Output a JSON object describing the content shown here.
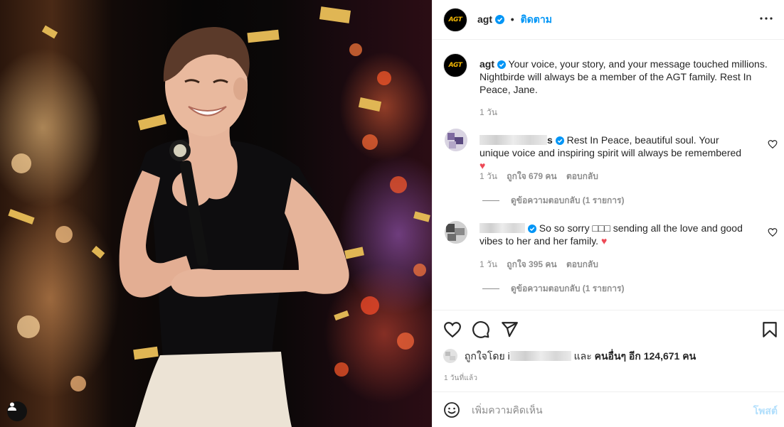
{
  "header": {
    "username": "agt",
    "avatar_logo_text": "AGT",
    "follow_label": "ติดตาม",
    "more_icon": "more-horizontal-icon"
  },
  "caption": {
    "username": "agt",
    "text": "Your voice, your story, and your message touched millions. Nightbirde will always be a member of the AGT family. Rest In Peace, Jane.",
    "time": "1 วัน"
  },
  "comments": [
    {
      "username_suffix": "s",
      "text": "Rest In Peace, beautiful soul. Your unique voice and inspiring spirit will always be remembered",
      "emoji": "♥",
      "time": "1 วัน",
      "likes": "ถูกใจ 679 คน",
      "reply_label": "ตอบกลับ",
      "view_replies": "ดูข้อความตอบกลับ (1 รายการ)"
    },
    {
      "username_suffix": "",
      "text": "So so sorry □□□ sending all the love and good vibes to her and her family.",
      "emoji": "♥",
      "time": "1 วัน",
      "likes": "ถูกใจ 395 คน",
      "reply_label": "ตอบกลับ",
      "view_replies": "ดูข้อความตอบกลับ (1 รายการ)"
    }
  ],
  "actions": {
    "icons": [
      "heart-icon",
      "comment-icon",
      "share-icon",
      "bookmark-icon"
    ],
    "likes_prefix": "ถูกใจโดย i",
    "likes_mid": "และ",
    "likes_others": "คนอื่นๆ อีก 124,671 คน",
    "time_ago": "1 วันที่แล้ว"
  },
  "add_comment": {
    "placeholder": "เพิ่มความคิดเห็น",
    "post_label": "โพสต์"
  },
  "colors": {
    "accent_blue": "#0095f6",
    "post_disabled": "#b2dffc",
    "heart_red": "#ed4956",
    "muted": "#8e8e8e"
  }
}
